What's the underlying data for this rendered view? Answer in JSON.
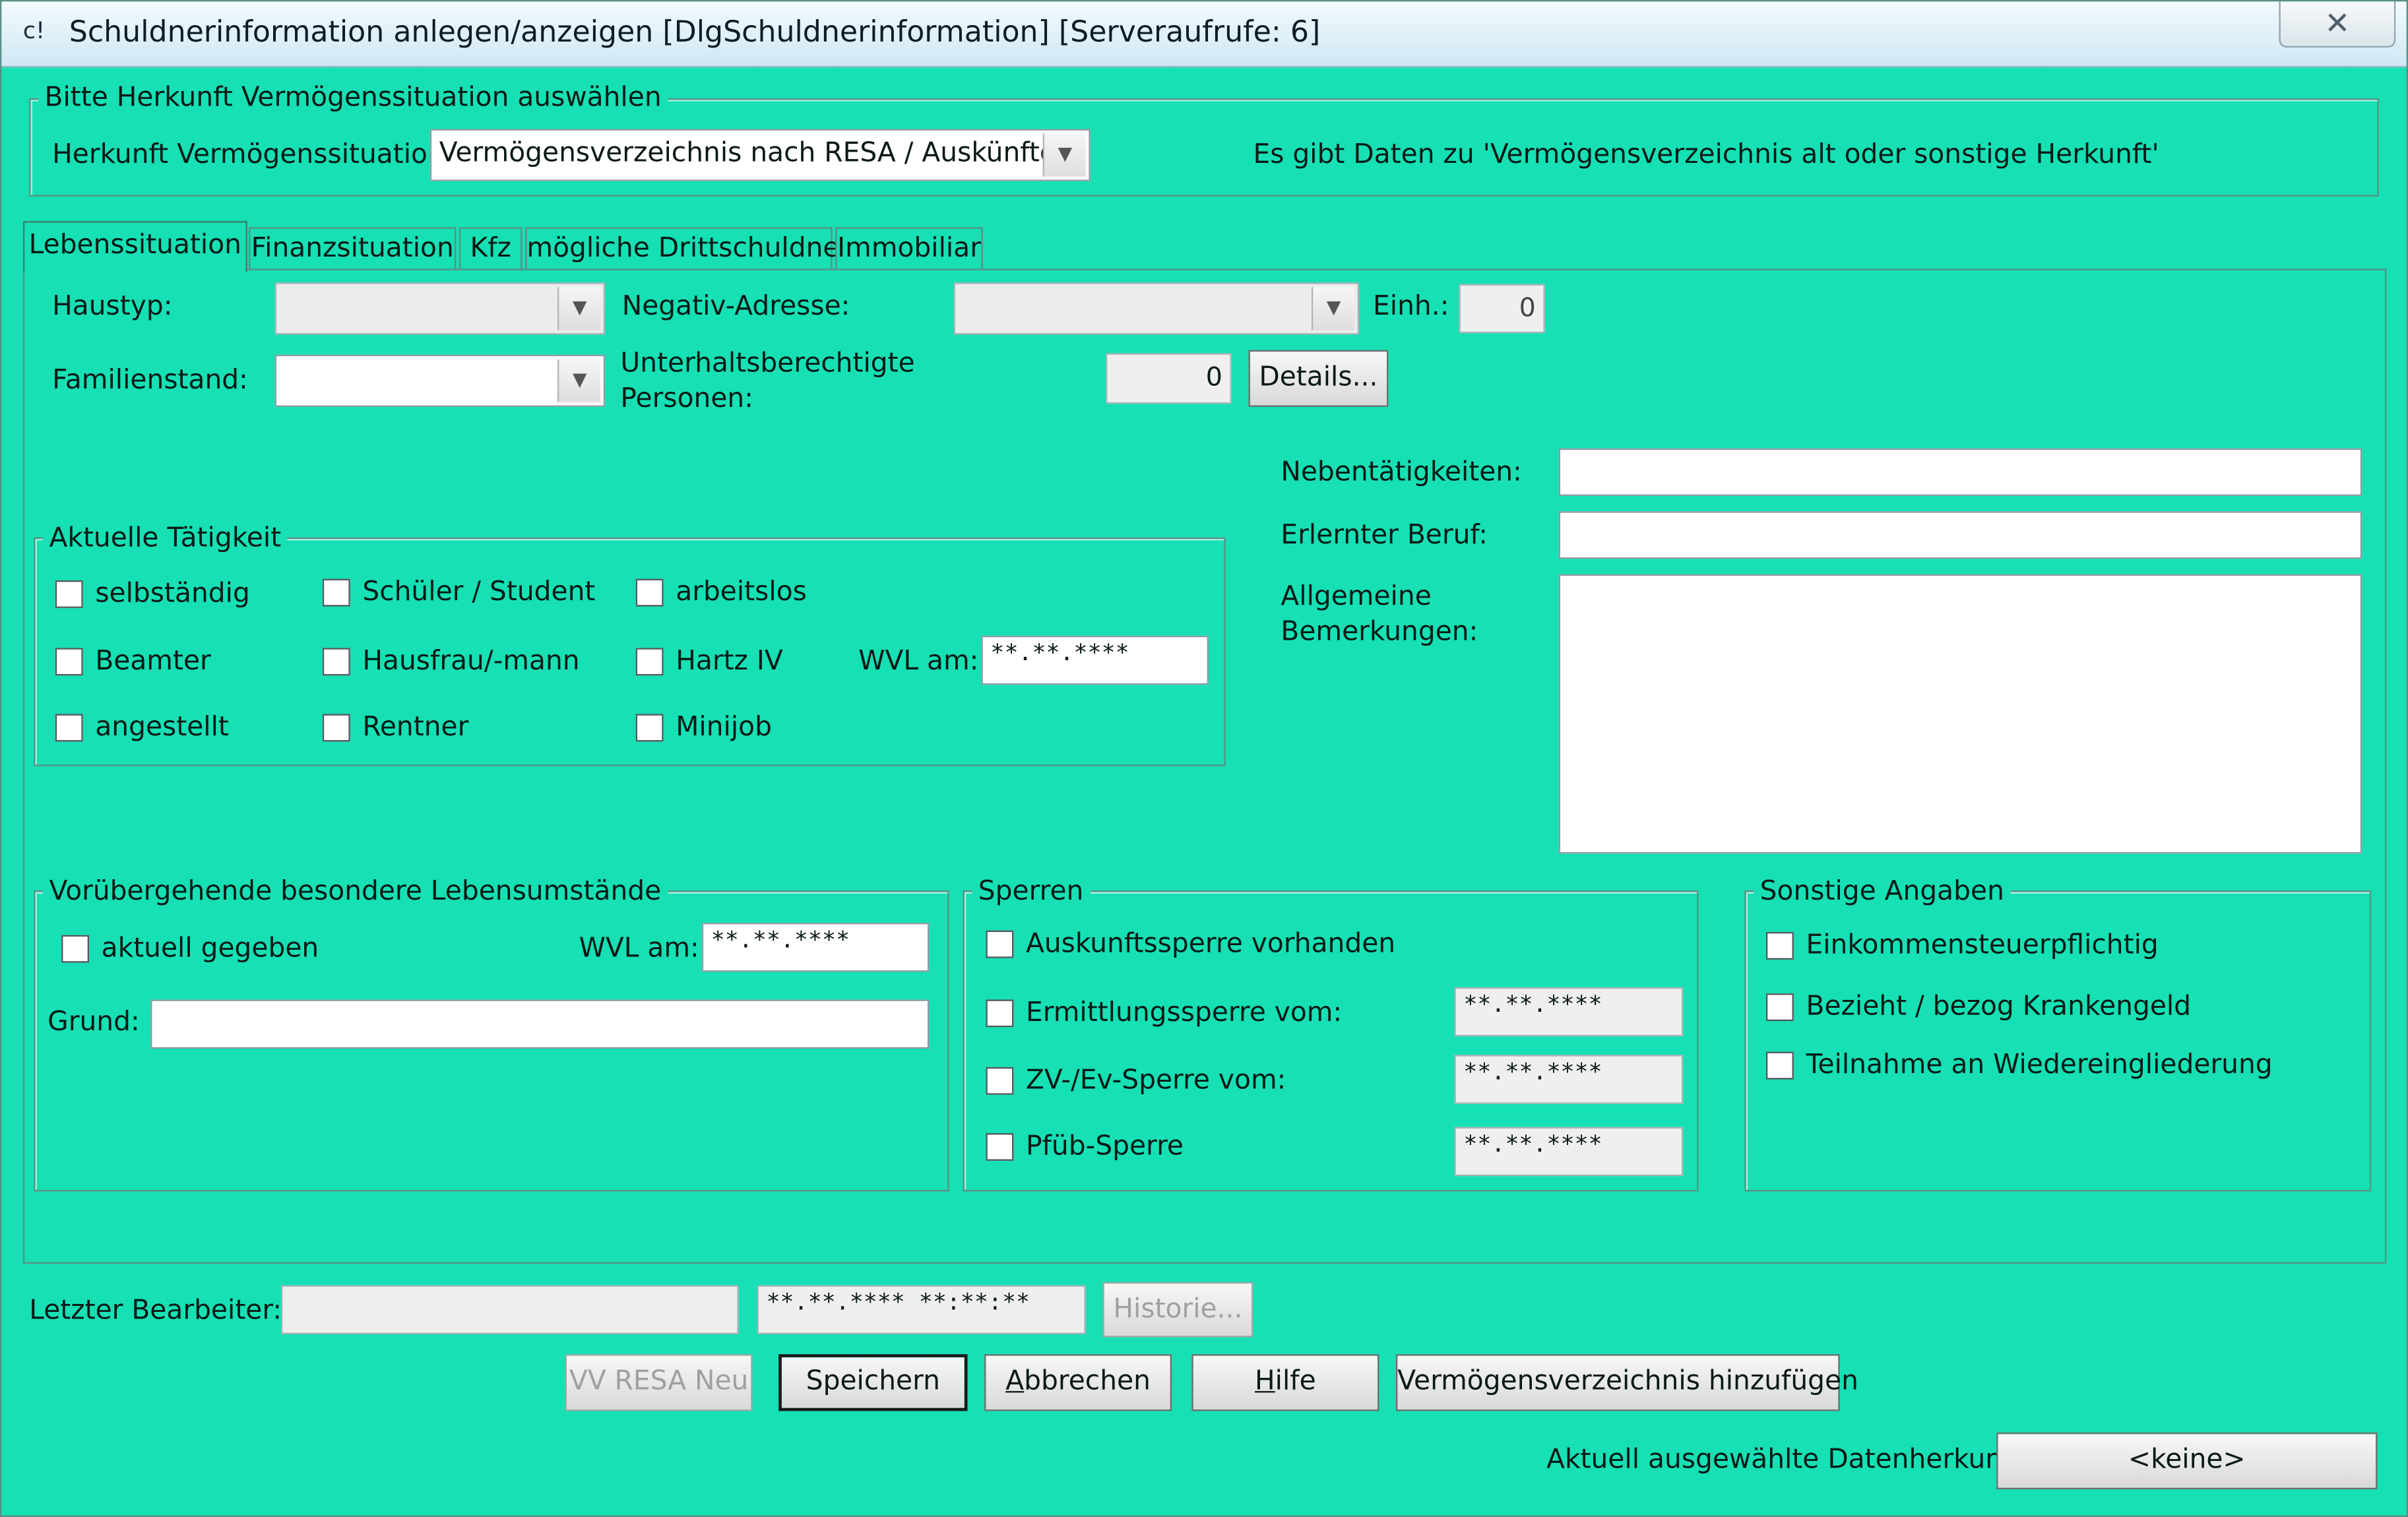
{
  "window": {
    "title": "Schuldnerinformation anlegen/anzeigen [DlgSchuldnerinformation] [Serveraufrufe: 6]",
    "app_icon_glyph": "c!",
    "close_glyph": "✕"
  },
  "herkunft_group": {
    "legend": "Bitte Herkunft Vermögenssituation auswählen",
    "label": "Herkunft Vermögenssituation:",
    "selected": "Vermögensverzeichnis nach RESA / Auskünfte...",
    "info": "Es gibt Daten zu 'Vermögensverzeichnis alt oder sonstige Herkunft'"
  },
  "tabs": [
    {
      "label": "Lebenssituation",
      "active": true
    },
    {
      "label": "Finanzsituation",
      "active": false
    },
    {
      "label": "Kfz",
      "active": false
    },
    {
      "label": "mögliche Drittschuldner",
      "active": false
    },
    {
      "label": "Immobiliar",
      "active": false
    }
  ],
  "lebens": {
    "haustyp_label": "Haustyp:",
    "haustyp_value": "",
    "negativ_label": "Negativ-Adresse:",
    "negativ_value": "",
    "einh_label": "Einh.:",
    "einh_value": "0",
    "familienstand_label": "Familienstand:",
    "familienstand_value": "",
    "unterhalt_label_1": "Unterhaltsberechtigte",
    "unterhalt_label_2": "Personen:",
    "unterhalt_value": "0",
    "details_button": "Details...",
    "nebentaetigkeiten_label": "Nebentätigkeiten:",
    "nebentaetigkeiten_value": "",
    "beruf_label": "Erlernter Beruf:",
    "beruf_value": "",
    "bemerkungen_label_1": "Allgemeine",
    "bemerkungen_label_2": "Bemerkungen:",
    "bemerkungen_value": ""
  },
  "taetigkeit": {
    "legend": "Aktuelle Tätigkeit",
    "options": [
      {
        "label": "selbständig",
        "checked": false
      },
      {
        "label": "Schüler / Student",
        "checked": false
      },
      {
        "label": "arbeitslos",
        "checked": false
      },
      {
        "label": "Beamter",
        "checked": false
      },
      {
        "label": "Hausfrau/-mann",
        "checked": false
      },
      {
        "label": "Hartz IV",
        "checked": false
      },
      {
        "label": "angestellt",
        "checked": false
      },
      {
        "label": "Rentner",
        "checked": false
      },
      {
        "label": "Minijob",
        "checked": false
      }
    ],
    "wvl_label": "WVL am:",
    "wvl_value": "**.**.****"
  },
  "umstaende": {
    "legend": "Vorübergehende besondere Lebensumstände",
    "aktuell_label": "aktuell gegeben",
    "aktuell_checked": false,
    "wvl_label": "WVL am:",
    "wvl_value": "**.**.****",
    "grund_label": "Grund:",
    "grund_value": ""
  },
  "sperren": {
    "legend": "Sperren",
    "items": [
      {
        "label": "Auskunftssperre vorhanden",
        "checked": false,
        "date": null
      },
      {
        "label": "Ermittlungssperre vom:",
        "checked": false,
        "date": "**.**.****"
      },
      {
        "label": "ZV-/Ev-Sperre vom:",
        "checked": false,
        "date": "**.**.****"
      },
      {
        "label": "Pfüb-Sperre",
        "checked": false,
        "date": "**.**.****"
      }
    ]
  },
  "sonstige": {
    "legend": "Sonstige Angaben",
    "items": [
      {
        "label": "Einkommensteuerpflichtig",
        "checked": false
      },
      {
        "label": "Bezieht / bezog Krankengeld",
        "checked": false
      },
      {
        "label": "Teilnahme an Wiedereingliederung",
        "checked": false
      }
    ]
  },
  "footer": {
    "bearbeiter_label": "Letzter Bearbeiter:",
    "bearbeiter_value": "",
    "timestamp_value": "**.**.**** **:**:**",
    "historie_button": "Historie...",
    "vv_resa_button": "VV RESA Neu",
    "speichern_button": "Speichern",
    "abbrechen_pre": "",
    "abbrechen_mnemonic": "A",
    "abbrechen_rest": "bbrechen",
    "hilfe_mnemonic": "H",
    "hilfe_rest": "ilfe",
    "vermoegensverzeichnis_button": "Vermögensverzeichnis hinzufügen",
    "datenherkunft_label": "Aktuell ausgewählte Datenherkunft:",
    "datenherkunft_value": "<keine>"
  },
  "colors": {
    "dialog_background": "#16e0b4",
    "group_border": "#5b8f84",
    "title_bar": "#dbeef7"
  }
}
